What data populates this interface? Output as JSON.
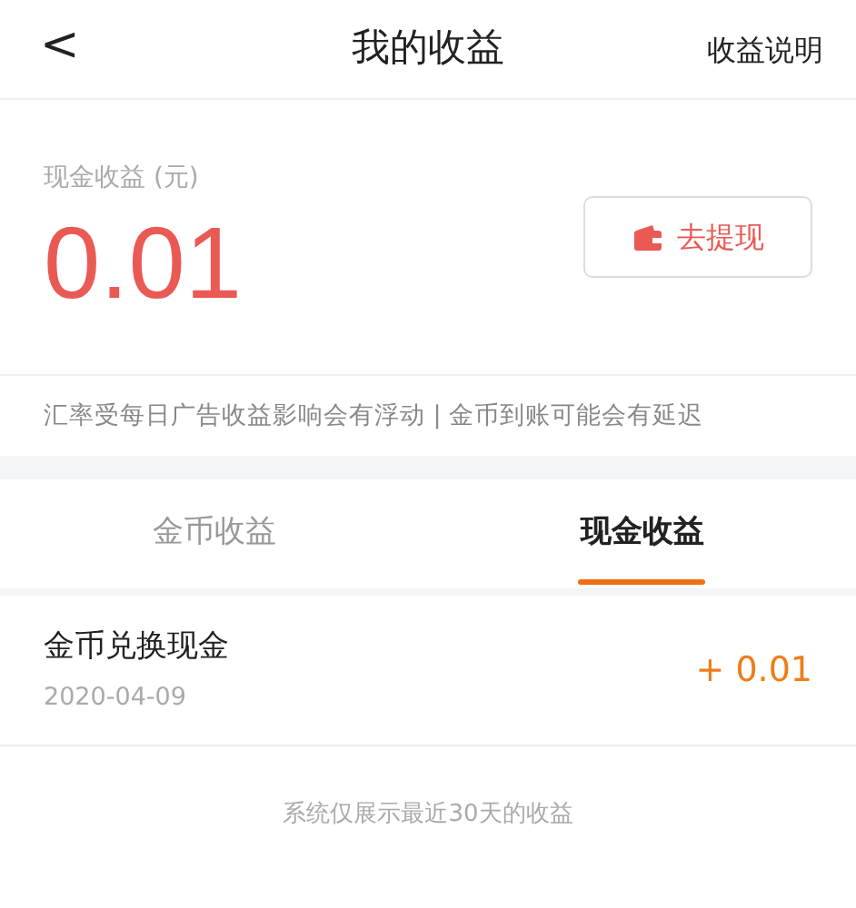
{
  "header": {
    "back": "<",
    "title": "我的收益",
    "action": "收益说明"
  },
  "balance": {
    "label": "现金收益 (元)",
    "amount": "0.01",
    "button": "去提现"
  },
  "notice": "汇率受每日广告收益影响会有浮动 | 金币到账可能会有延迟",
  "tabs": [
    {
      "label": "金币收益",
      "selected": false
    },
    {
      "label": "现金收益",
      "selected": true
    }
  ],
  "records": [
    {
      "title": "金币兑换现金",
      "date": "2020-04-09",
      "amount": "+ 0.01"
    }
  ],
  "footer": "系统仅展示最近30天的收益"
}
